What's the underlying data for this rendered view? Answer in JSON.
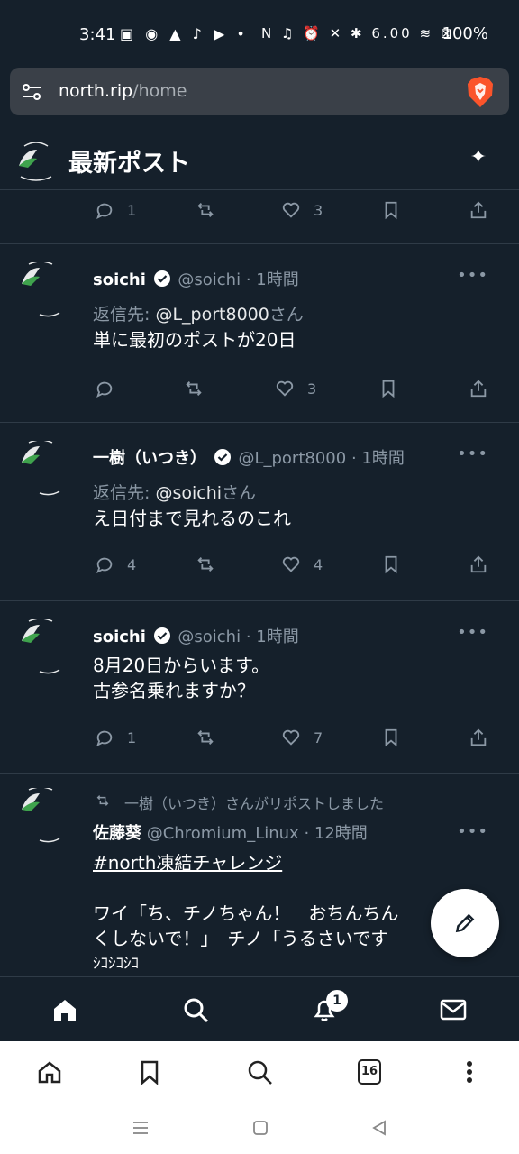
{
  "status_bar": {
    "time": "3:41",
    "left_icons": "▣ ◉ ▲ ♪ ▶ •",
    "right_icons": "N ♫ ⏰ ✕ ✱ 6.00 ≋ ⊠",
    "battery": "100%"
  },
  "browser": {
    "url_host": "north.rip",
    "url_path": "/home"
  },
  "header": {
    "title": "最新ポスト"
  },
  "posts": [
    {
      "replies": "1",
      "reposts": "",
      "likes": "3"
    },
    {
      "name": "soichi",
      "handle": "@soichi",
      "time": "· 1時間",
      "reply_prefix": "返信先: ",
      "reply_to": "@L_port8000",
      "reply_suffix": "さん",
      "text": "単に最初のポストが20日",
      "replies": "",
      "reposts": "",
      "likes": "3"
    },
    {
      "name": "一樹（いつき）",
      "handle": "@L_port8000",
      "time": "· 1時間",
      "reply_prefix": "返信先: ",
      "reply_to": "@soichi",
      "reply_suffix": "さん",
      "text": "え日付まで見れるのこれ",
      "replies": "4",
      "reposts": "",
      "likes": "4"
    },
    {
      "name": "soichi",
      "handle": "@soichi",
      "time": "· 1時間",
      "text_line1": "8月20日からいます。",
      "text_line2": "古参名乗れますか？",
      "replies": "1",
      "reposts": "",
      "likes": "7"
    },
    {
      "repost_note": "一樹（いつき）さんがリポストしました",
      "name": "佐藤葵",
      "handle": "@Chromium_Linux",
      "time": "· 12時間",
      "hashtag": "#north凍結チャレンジ",
      "text_line1": "ワイ「ち、チノちゃん！　おちんちん",
      "text_line2": "くしないで！」　チノ「うるさいです",
      "text_line3": "ｼｺｼｺｼｺ"
    }
  ],
  "app_nav": {
    "notification_count": "1"
  },
  "browser_toolbar": {
    "tab_count": "16"
  },
  "icons": {
    "reply": "reply-icon",
    "repost": "repost-icon",
    "like": "heart-icon",
    "bookmark": "bookmark-icon",
    "share": "share-icon",
    "compose": "pencil-icon"
  },
  "colors": {
    "background": "#15202b",
    "muted_text": "#8b98a5",
    "divider": "#2f3b47"
  }
}
